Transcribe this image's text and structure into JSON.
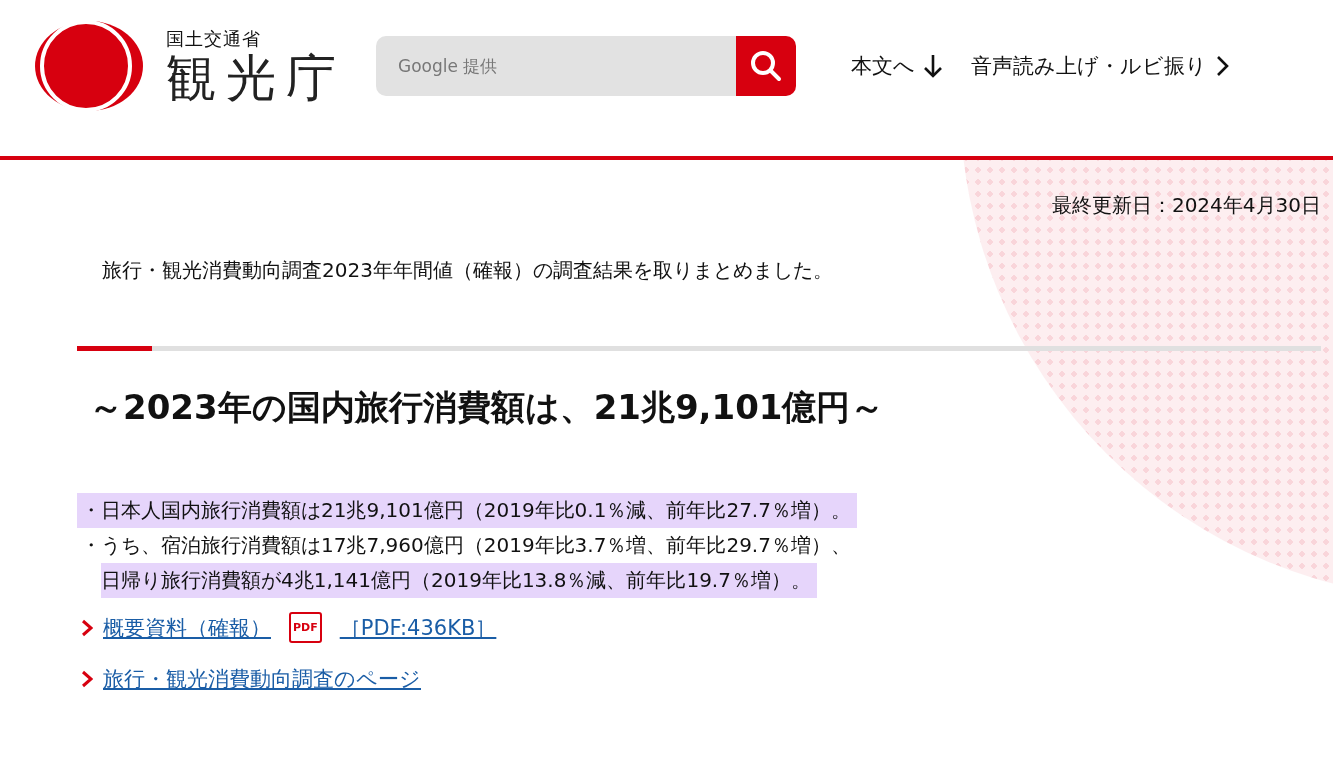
{
  "logo": {
    "ministry": "国土交通省",
    "agency": "観光庁"
  },
  "search": {
    "placeholder": "Google 提供"
  },
  "nav": [
    {
      "label": "本文へ",
      "kind": "jump"
    },
    {
      "label": "音声読み上げ・ルビ振り",
      "kind": "link"
    }
  ],
  "updated": "最終更新日：2024年4月30日",
  "intro": "旅行・観光消費動向調査2023年年間値（確報）の調査結果を取りまとめました。",
  "heading": "～2023年の国内旅行消費額は、21兆9,101億円～",
  "bullets": [
    {
      "marker": "・",
      "lines": [
        {
          "text": "日本人国内旅行消費額は21兆9,101億円（2019年比0.1％減、前年比27.7％増）。",
          "highlighted": true
        }
      ]
    },
    {
      "marker": "・",
      "lines": [
        {
          "text": "うち、宿泊旅行消費額は17兆7,960億円（2019年比3.7％増、前年比29.7％増）、",
          "highlighted": false
        },
        {
          "text": "日帰り旅行消費額が4兆1,141億円（2019年比13.8％減、前年比19.7％増）。",
          "highlighted": true
        }
      ]
    }
  ],
  "links": [
    {
      "text": "概要資料（確報）",
      "badge": "PDF",
      "size": "［PDF:436KB］"
    },
    {
      "text": "旅行・観光消費動向調査のページ"
    }
  ]
}
